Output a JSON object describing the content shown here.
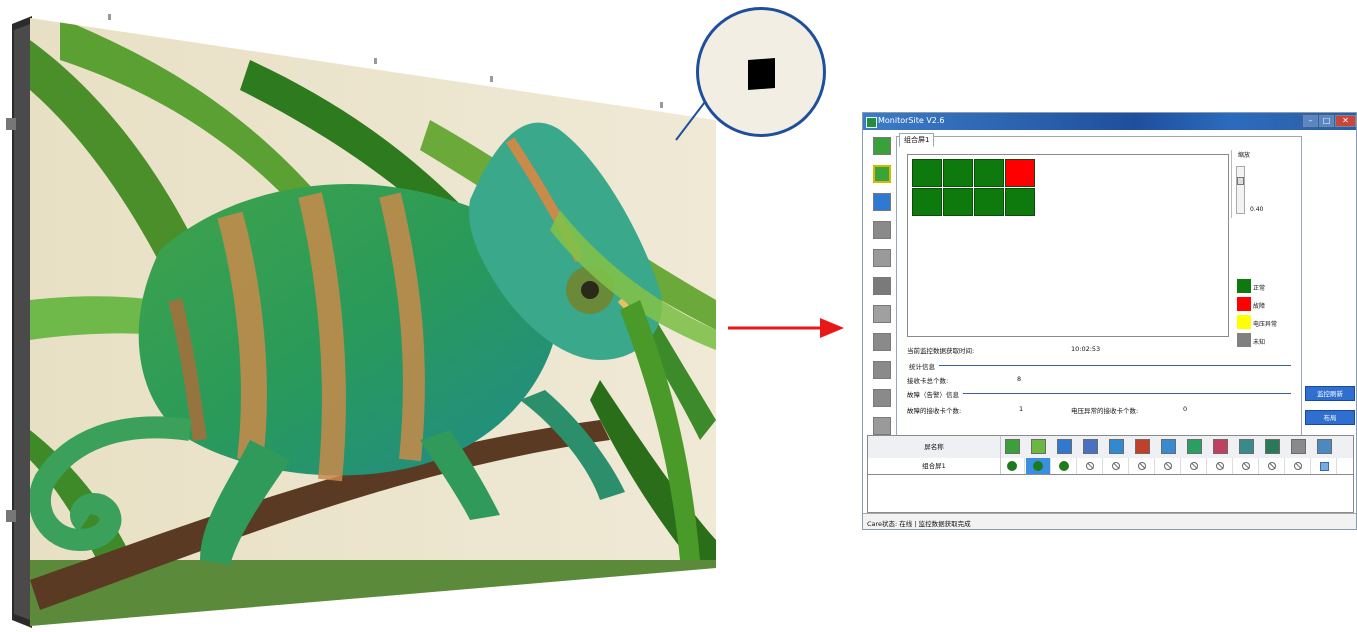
{
  "window": {
    "title": "MonitorSite V2.6",
    "min_glyph": "–",
    "max_glyph": "□",
    "close_glyph": "✕"
  },
  "toolbar": {
    "icons": [
      "receiving-card-icon",
      "module-icon",
      "temperature-icon",
      "humidity-icon",
      "smoke-icon",
      "cabinet-door-icon",
      "fan-icon",
      "voltage-icon",
      "magnet-icon",
      "exit-icon",
      "keyboard-icon"
    ],
    "active_index": 1
  },
  "group_tab": "组合屏1",
  "zoom": {
    "label": "缩放",
    "value": "0.40"
  },
  "grid": {
    "rows": 2,
    "cols": 4,
    "statuses": [
      [
        "normal",
        "normal",
        "normal",
        "fault"
      ],
      [
        "normal",
        "normal",
        "normal",
        "normal"
      ]
    ]
  },
  "legend": [
    {
      "label": "正常",
      "color": "#0e7a0e"
    },
    {
      "label": "故障",
      "color": "#ff0000"
    },
    {
      "label": "电压异常",
      "color": "#ffff00"
    },
    {
      "label": "未知",
      "color": "#808080"
    }
  ],
  "info": {
    "fetch_time_label": "当前监控数据获取时间:",
    "fetch_time_value": "10:02:53",
    "stats_header": "统计信息",
    "card_total_label": "接收卡总个数:",
    "card_total_value": "8",
    "fault_header": "故障（告警）信息",
    "fault_card_label": "故障的接收卡个数:",
    "fault_card_value": "1",
    "voltage_card_label": "电压异常的接收卡个数:",
    "voltage_card_value": "0"
  },
  "side_buttons": {
    "refresh": "监控刷新",
    "layout": "布局"
  },
  "table": {
    "name_header": "屏名称",
    "rows": [
      {
        "name": "组合屏1",
        "cells": [
          "dot",
          "dot-selected",
          "dot",
          "none",
          "none",
          "none",
          "none",
          "none",
          "none",
          "none",
          "none",
          "none",
          "square"
        ]
      }
    ]
  },
  "status": "Care状态: 在线 | 监控数据获取完成",
  "colors": {
    "normal": "#0e7a0e",
    "fault": "#ff0000",
    "accent": "#2f6fd0",
    "callout_border": "#1f4e9c",
    "arrow": "#e81818"
  }
}
